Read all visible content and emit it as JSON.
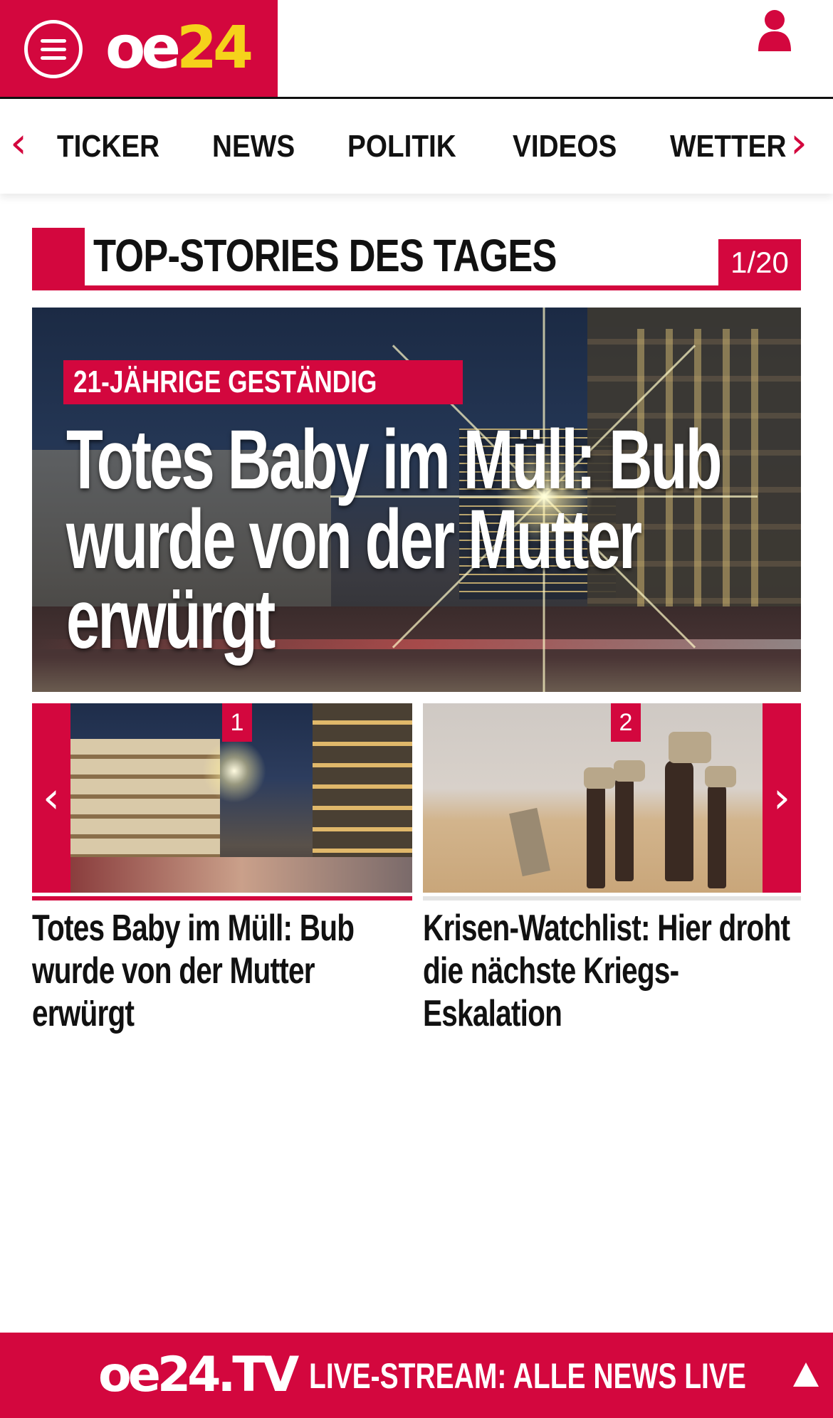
{
  "header": {
    "logo_main": "oe",
    "logo_number": "24",
    "menu_icon": "hamburger-menu-icon",
    "user_icon": "user-icon"
  },
  "nav": {
    "prev_icon": "chevron-left-icon",
    "next_icon": "chevron-right-icon",
    "items": [
      {
        "label": "TICKER"
      },
      {
        "label": "NEWS"
      },
      {
        "label": "POLITIK"
      },
      {
        "label": "VIDEOS"
      },
      {
        "label": "WETTER"
      }
    ]
  },
  "section": {
    "title": "TOP-STORIES DES TAGES",
    "counter": "1/20"
  },
  "hero": {
    "kicker": "21-JÄHRIGE GESTÄNDIG",
    "headline": "Totes Baby im Müll: Bub wurde von der Mutter erwürgt"
  },
  "carousel": {
    "prev_icon": "chevron-left-icon",
    "next_icon": "chevron-right-icon",
    "cards": [
      {
        "number": "1",
        "title": "Totes Baby im Müll: Bub wurde von der Mutter erwürgt"
      },
      {
        "number": "2",
        "title": "Krisen-Watchlist: Hier droht die nächste Kriegs-Eskalation"
      }
    ]
  },
  "bottom_bar": {
    "tv_logo": "oe24.TV",
    "live_label": "LIVE-STREAM:",
    "live_text": "ALLE NEWS LIVE",
    "up_icon": "triangle-up-icon"
  },
  "colors": {
    "brand_red": "#d3073e",
    "logo_yellow": "#f5d21b"
  }
}
